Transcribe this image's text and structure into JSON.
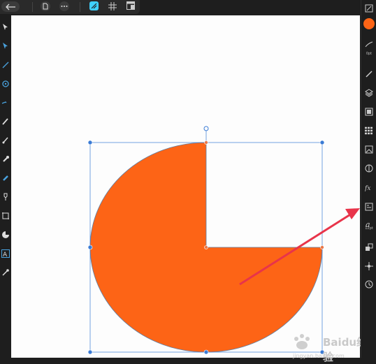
{
  "colors": {
    "shape_fill": "#fd6416",
    "shape_stroke": "#5b7ea5",
    "selection": "#3a7bd5",
    "handle_orange": "#e9784a",
    "arrow": "#e8344a",
    "canvas": "#fdfdfd",
    "chrome": "#1e1e1e"
  },
  "toolbar": {
    "back_icon": "back-arrow-icon",
    "document_icon": "document-icon",
    "more_icon": "more-dots-icon",
    "persona_icon": "designer-persona-icon",
    "grid_icon": "grid-icon",
    "view_icon": "view-mode-icon"
  },
  "left_tools": [
    "move-tool-icon",
    "node-tool-icon",
    "corner-tool-icon",
    "pen-tool-icon",
    "pencil-tool-icon",
    "vector-brush-tool-icon",
    "fill-tool-icon",
    "transparency-tool-icon",
    "crop-tool-icon",
    "shape-tool-icon",
    "text-tool-icon",
    "color-picker-tool-icon"
  ],
  "right_panel": {
    "stroke_width_label": "0pt",
    "font_size_label": "12pt",
    "icons": [
      "transform-icon",
      "color-icon",
      "stroke-icon",
      "brush-icon",
      "layers-icon",
      "stock-icon",
      "swatches-icon",
      "image-icon",
      "adjustments-icon",
      "fx-icon",
      "text-style-icon",
      "character-icon",
      "quick-fx-icon",
      "constraints-icon",
      "history-icon"
    ]
  },
  "canvas": {
    "shape": "pie",
    "watermark_text": "Baidu经验",
    "watermark_url": "jingyan.baidu.com"
  }
}
